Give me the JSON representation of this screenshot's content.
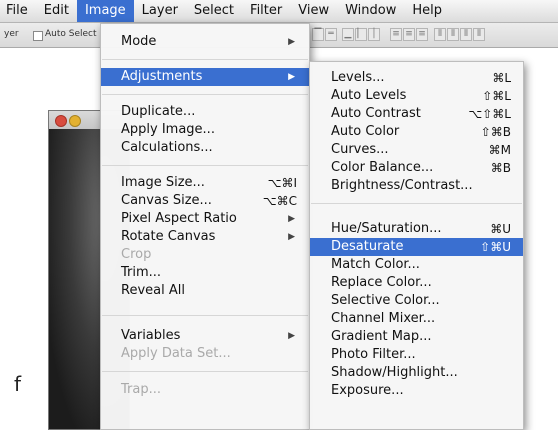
{
  "menubar": {
    "items": [
      {
        "label": "File"
      },
      {
        "label": "Edit"
      },
      {
        "label": "Image"
      },
      {
        "label": "Layer"
      },
      {
        "label": "Select"
      },
      {
        "label": "Filter"
      },
      {
        "label": "View"
      },
      {
        "label": "Window"
      },
      {
        "label": "Help"
      }
    ],
    "active": "Image"
  },
  "options_bar": {
    "layer_label": "yer",
    "auto_select_label": "Auto Select"
  },
  "image_menu": {
    "items": [
      {
        "label": "Mode",
        "submenu": true
      },
      {
        "label": "Adjustments",
        "submenu": true,
        "highlighted": true
      },
      {
        "label": "Duplicate..."
      },
      {
        "label": "Apply Image..."
      },
      {
        "label": "Calculations..."
      },
      {
        "label": "Image Size...",
        "shortcut": "⌥⌘I"
      },
      {
        "label": "Canvas Size...",
        "shortcut": "⌥⌘C"
      },
      {
        "label": "Pixel Aspect Ratio",
        "submenu": true
      },
      {
        "label": "Rotate Canvas",
        "submenu": true
      },
      {
        "label": "Crop",
        "disabled": true
      },
      {
        "label": "Trim..."
      },
      {
        "label": "Reveal All"
      },
      {
        "label": "Variables",
        "submenu": true
      },
      {
        "label": "Apply Data Set...",
        "disabled": true
      },
      {
        "label": "Trap...",
        "disabled": true
      }
    ]
  },
  "adjustments_menu": {
    "items": [
      {
        "label": "Levels...",
        "shortcut": "⌘L"
      },
      {
        "label": "Auto Levels",
        "shortcut": "⇧⌘L"
      },
      {
        "label": "Auto Contrast",
        "shortcut": "⌥⇧⌘L"
      },
      {
        "label": "Auto Color",
        "shortcut": "⇧⌘B"
      },
      {
        "label": "Curves...",
        "shortcut": "⌘M"
      },
      {
        "label": "Color Balance...",
        "shortcut": "⌘B"
      },
      {
        "label": "Brightness/Contrast..."
      },
      {
        "label": "Hue/Saturation...",
        "shortcut": "⌘U"
      },
      {
        "label": "Desaturate",
        "shortcut": "⇧⌘U",
        "highlighted": true
      },
      {
        "label": "Match Color..."
      },
      {
        "label": "Replace Color..."
      },
      {
        "label": "Selective Color..."
      },
      {
        "label": "Channel Mixer..."
      },
      {
        "label": "Gradient Map..."
      },
      {
        "label": "Photo Filter..."
      },
      {
        "label": "Shadow/Highlight..."
      },
      {
        "label": "Exposure..."
      }
    ]
  },
  "stray_text": "f",
  "colors": {
    "highlight": "#3a6fd0"
  }
}
